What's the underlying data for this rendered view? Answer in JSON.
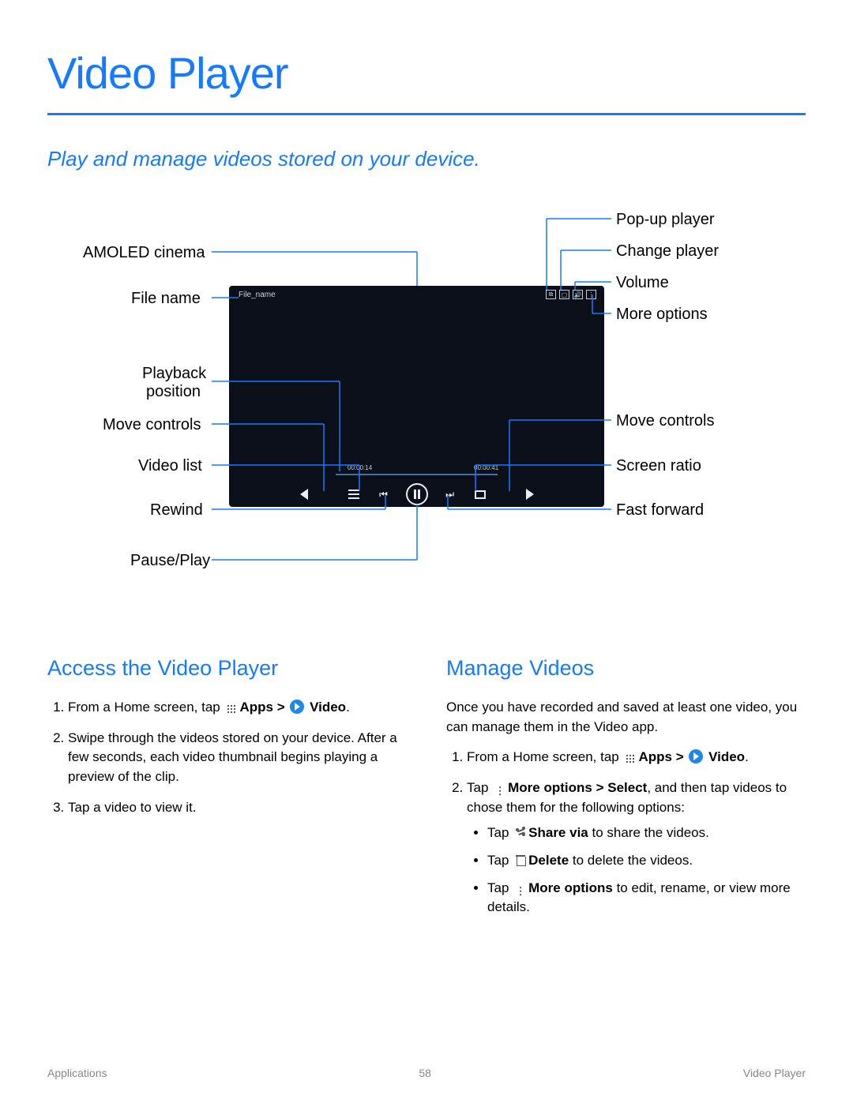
{
  "title": "Video Player",
  "subtitle": "Play and manage videos stored on your device.",
  "labels": {
    "amoled": "AMOLED cinema",
    "filename": "File name",
    "playback1": "Playback",
    "playback2": "position",
    "movectrlL": "Move controls",
    "videolist": "Video list",
    "rewind": "Rewind",
    "pauseplay": "Pause/Play",
    "popup": "Pop-up player",
    "changeplayer": "Change player",
    "volume": "Volume",
    "moreopt": "More options",
    "movectrlR": "Move controls",
    "screenratio": "Screen ratio",
    "fastfwd": "Fast forward"
  },
  "phone": {
    "filename": "File_name",
    "time_l": "00:00:14",
    "time_r": "00:00:41"
  },
  "sections": {
    "access": {
      "heading": "Access the Video Player",
      "step1_a": "From a Home screen, tap ",
      "step1_b": "Apps > ",
      "step1_c": "Video",
      "step1_d": ".",
      "step2": "Swipe through the videos stored on your device. After a few seconds, each video thumbnail begins playing a preview of the clip.",
      "step3": "Tap a video to view it."
    },
    "manage": {
      "heading": "Manage Videos",
      "intro": "Once you have recorded and saved at least one video, you can manage them in the Video app.",
      "step1_a": "From a Home screen, tap ",
      "step1_b": "Apps > ",
      "step1_c": "Video",
      "step1_d": ".",
      "step2_a": "Tap ",
      "step2_b": "More options > Select",
      "step2_c": ", and then tap videos to chose them for the following options:",
      "b1_a": "Tap ",
      "b1_b": "Share via",
      "b1_c": " to share the videos.",
      "b2_a": "Tap ",
      "b2_b": "Delete",
      "b2_c": "  to delete the videos.",
      "b3_a": "Tap ",
      "b3_b": "More options",
      "b3_c": " to edit, rename, or view more details."
    }
  },
  "footer": {
    "left": "Applications",
    "center": "58",
    "right": "Video Player"
  }
}
